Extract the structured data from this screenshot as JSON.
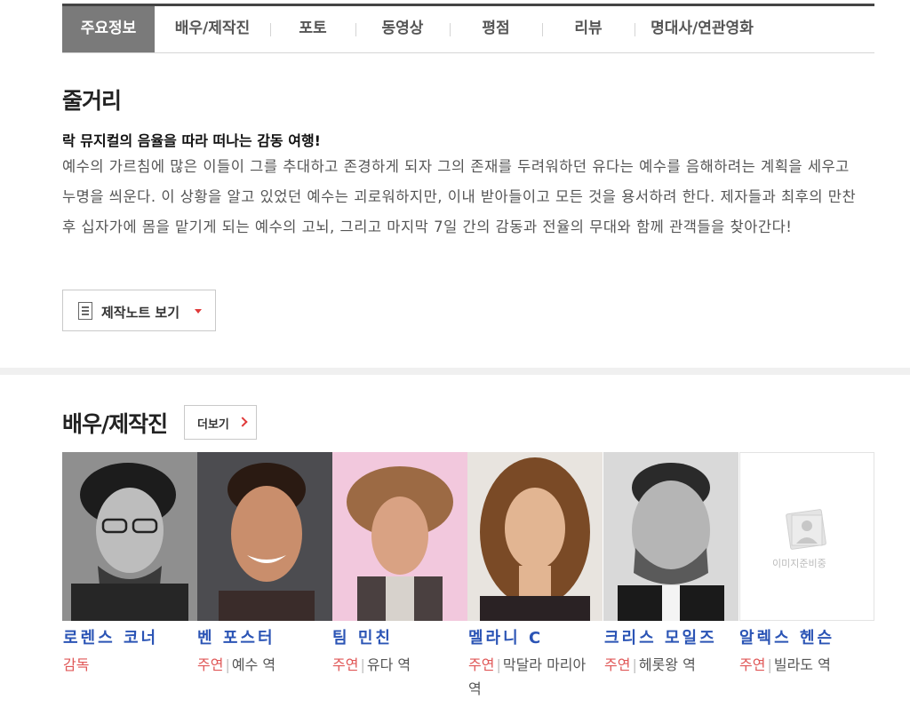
{
  "tabs": [
    {
      "label": "주요정보"
    },
    {
      "label": "배우/제작진"
    },
    {
      "label": "포토"
    },
    {
      "label": "동영상"
    },
    {
      "label": "평점"
    },
    {
      "label": "리뷰"
    },
    {
      "label": "명대사/연관영화"
    }
  ],
  "synopsis": {
    "title": "줄거리",
    "tagline": "락 뮤지컬의 음율을 따라 떠나는 감동 여행!",
    "body": "예수의 가르침에 많은 이들이 그를 추대하고 존경하게 되자 그의 존재를 두려워하던 유다는 예수를 음해하려는 계획을 세우고 누명을 씌운다. 이 상황을 알고 있었던 예수는 괴로워하지만, 이내 받아들이고 모든 것을 용서하려 한다. 제자들과 최후의 만찬 후 십자가에 몸을 맡기게 되는 예수의 고뇌, 그리고 마지막 7일 간의 감동과 전율의 무대와 함께 관객들을 찾아간다!",
    "note_button": "제작노트 보기",
    "note_icon": "document-icon"
  },
  "cast_section": {
    "title": "배우/제작진",
    "more_button": "더보기",
    "more_icon": "chevron-right-icon",
    "placeholder_text": "이미지준비중"
  },
  "cast": [
    {
      "name": "로렌스 코너",
      "role_type": "감독",
      "role": ""
    },
    {
      "name": "벤 포스터",
      "role_type": "주연",
      "role": "예수 역"
    },
    {
      "name": "팀 민친",
      "role_type": "주연",
      "role": "유다 역"
    },
    {
      "name": "멜라니 C",
      "role_type": "주연",
      "role": "막달라 마리아 역"
    },
    {
      "name": "크리스 모일즈",
      "role_type": "주연",
      "role": "헤롯왕 역"
    },
    {
      "name": "알렉스 헨슨",
      "role_type": "주연",
      "role": "빌라도 역"
    }
  ],
  "colors": {
    "accent": "#e05858",
    "name_link": "#2b54b5",
    "active_tab": "#7a7a7a"
  }
}
